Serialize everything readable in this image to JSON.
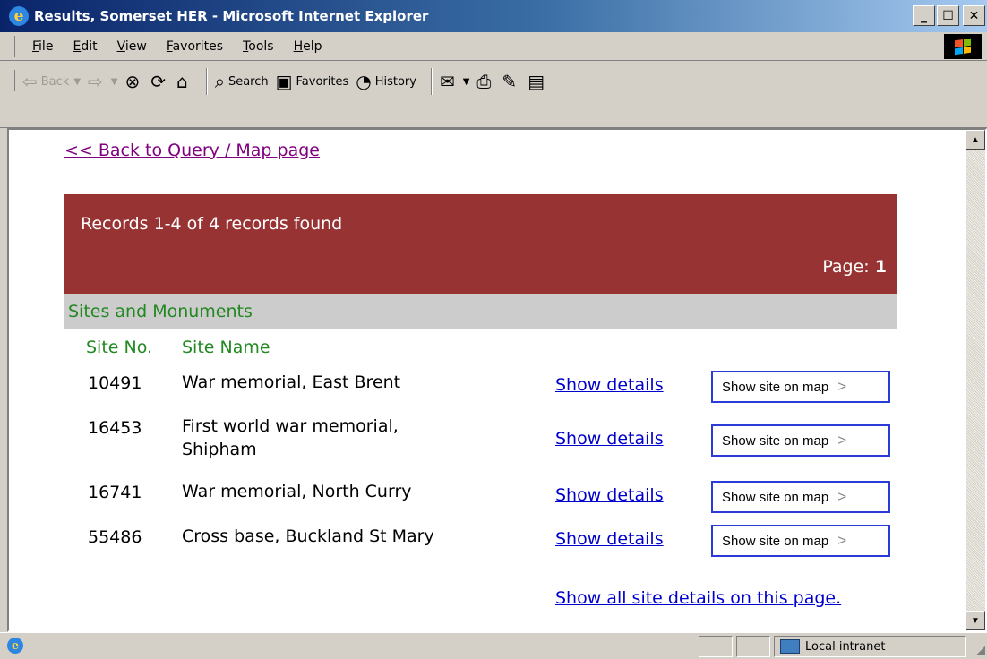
{
  "window": {
    "title": "Results, Somerset HER - Microsoft Internet Explorer",
    "minimize": "_",
    "maximize": "☐",
    "close": "✕"
  },
  "menu": [
    "File",
    "Edit",
    "View",
    "Favorites",
    "Tools",
    "Help"
  ],
  "toolbar": {
    "back": "Back",
    "search": "Search",
    "favorites": "Favorites",
    "history": "History"
  },
  "page": {
    "back_link": "<< Back to Query / Map page",
    "records_found": "Records 1-4 of 4 records found",
    "page_label": "Page:",
    "page_number": "1",
    "section_title": "Sites and Monuments",
    "col_site_no": "Site No.",
    "col_site_name": "Site Name",
    "details_label": "Show details",
    "map_label": "Show site on map",
    "rows": [
      {
        "site_no": "10491",
        "site_name": "War memorial, East Brent"
      },
      {
        "site_no": "16453",
        "site_name": "First world war memorial, Shipham"
      },
      {
        "site_no": "16741",
        "site_name": "War memorial, North Curry"
      },
      {
        "site_no": "55486",
        "site_name": "Cross base, Buckland St Mary"
      }
    ],
    "all_details": "Show all site details on this page."
  },
  "status": {
    "zone": "Local intranet"
  },
  "colors": {
    "header_band": "#983334",
    "section_header": "#cccccc",
    "green_text": "#228822",
    "link": "#0000cc",
    "visited_link": "#800080"
  }
}
